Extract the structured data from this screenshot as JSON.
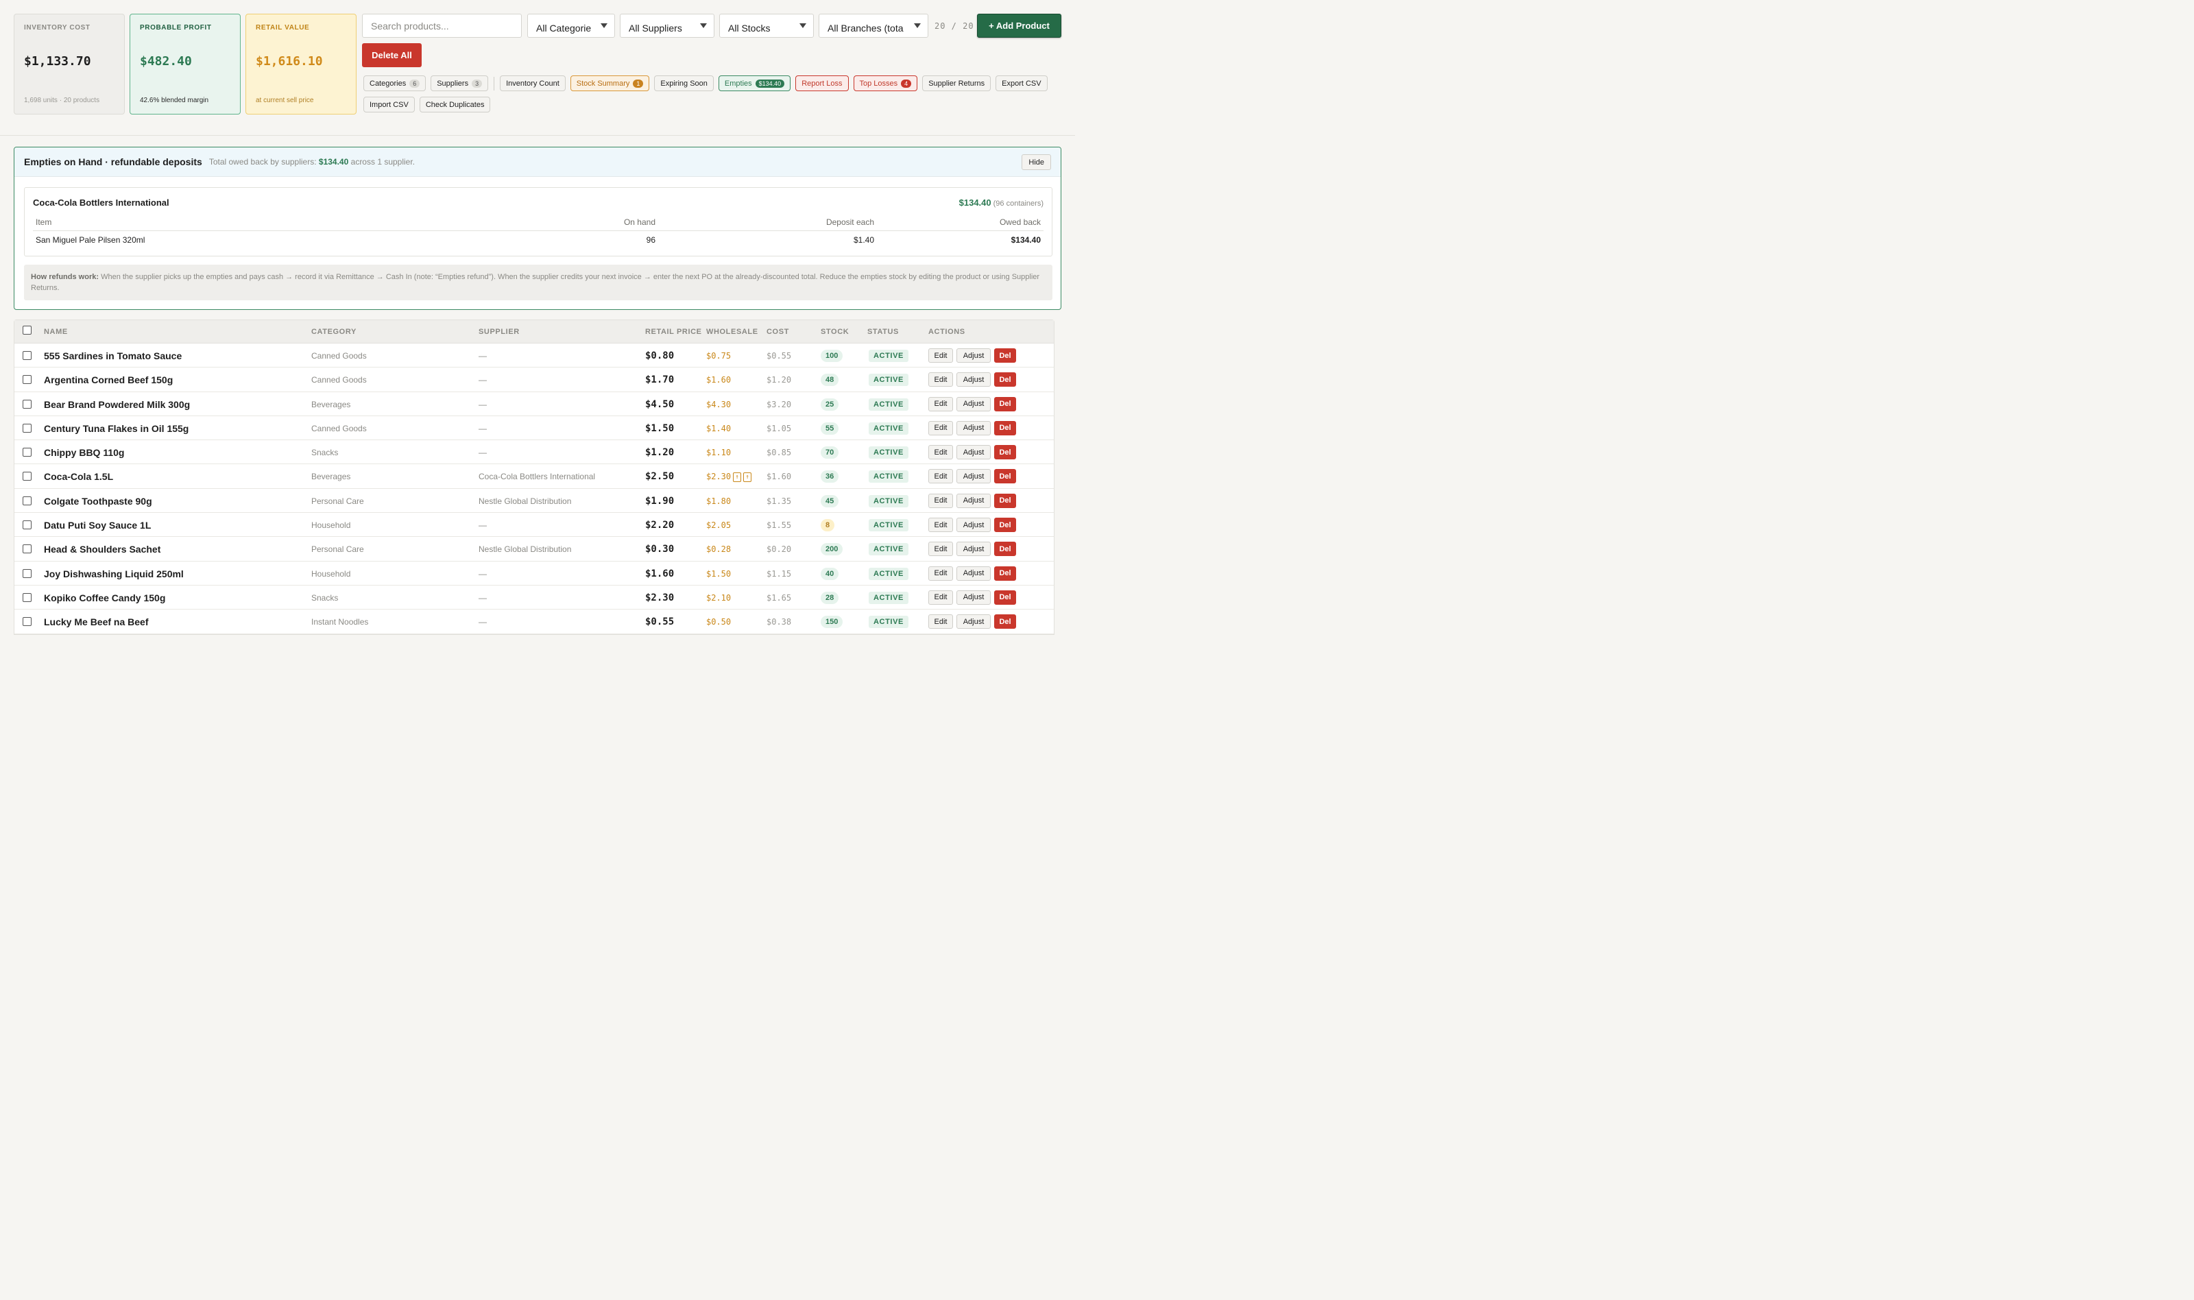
{
  "stats": {
    "inventory_cost": {
      "label": "INVENTORY COST",
      "value": "$1,133.70",
      "sub": "1,698 units · 20 products"
    },
    "probable_profit": {
      "label": "PROBABLE PROFIT",
      "value": "$482.40",
      "sub": "42.6% blended margin"
    },
    "retail_value": {
      "label": "RETAIL VALUE",
      "value": "$1,616.10",
      "sub": "at current sell price"
    }
  },
  "toolbar": {
    "search_placeholder": "Search products...",
    "filter_category": "All Categorie",
    "filter_supplier": "All Suppliers",
    "filter_stock": "All Stocks",
    "filter_branch": "All Branches (tota",
    "count": "20 / 20",
    "add_product": "+ Add Product",
    "delete_all": "Delete All"
  },
  "chips": {
    "categories": {
      "label": "Categories",
      "badge": "6"
    },
    "suppliers": {
      "label": "Suppliers",
      "badge": "3"
    },
    "inventory_count": {
      "label": "Inventory Count"
    },
    "stock_summary": {
      "label": "Stock Summary",
      "badge": "1"
    },
    "expiring_soon": {
      "label": "Expiring Soon"
    },
    "empties": {
      "label": "Empties",
      "badge": "$134.40"
    },
    "report_loss": {
      "label": "Report Loss"
    },
    "top_losses": {
      "label": "Top Losses",
      "badge": "4"
    },
    "supplier_returns": {
      "label": "Supplier Returns"
    },
    "export_csv": {
      "label": "Export CSV"
    },
    "import_csv": {
      "label": "Import CSV"
    },
    "check_duplicates": {
      "label": "Check Duplicates"
    }
  },
  "empties": {
    "title": "Empties on Hand · refundable deposits",
    "note_prefix": "Total owed back by suppliers:",
    "note_amount": "$134.40",
    "note_suffix": "across 1 supplier.",
    "hide": "Hide",
    "supplier": {
      "name": "Coca-Cola Bottlers International",
      "total": "$134.40",
      "containers": "(96 containers)",
      "headers": {
        "item": "Item",
        "on_hand": "On hand",
        "deposit_each": "Deposit each",
        "owed_back": "Owed back"
      },
      "row": {
        "item": "San Miguel Pale Pilsen 320ml",
        "on_hand": "96",
        "deposit_each": "$1.40",
        "owed_back": "$134.40"
      }
    },
    "how_label": "How refunds work:",
    "how_text": "When the supplier picks up the empties and pays cash → record it via Remittance → Cash In (note: “Empties refund”). When the supplier credits your next invoice → enter the next PO at the already-discounted total. Reduce the empties stock by editing the product or using Supplier Returns."
  },
  "table": {
    "headers": {
      "name": "NAME",
      "category": "CATEGORY",
      "supplier": "SUPPLIER",
      "retail": "RETAIL PRICE",
      "wholesale": "WHOLESALE",
      "cost": "COST",
      "stock": "STOCK",
      "status": "STATUS",
      "actions": "ACTIONS"
    },
    "action_labels": {
      "edit": "Edit",
      "adjust": "Adjust",
      "del": "Del"
    },
    "rows": [
      {
        "name": "555 Sardines in Tomato Sauce",
        "category": "Canned Goods",
        "supplier": "—",
        "retail": "$0.80",
        "wholesale": "$0.75",
        "cost": "$0.55",
        "stock": "100",
        "status": "ACTIVE"
      },
      {
        "name": "Argentina Corned Beef 150g",
        "category": "Canned Goods",
        "supplier": "—",
        "retail": "$1.70",
        "wholesale": "$1.60",
        "cost": "$1.20",
        "stock": "48",
        "status": "ACTIVE"
      },
      {
        "name": "Bear Brand Powdered Milk 300g",
        "category": "Beverages",
        "supplier": "—",
        "retail": "$4.50",
        "wholesale": "$4.30",
        "cost": "$3.20",
        "stock": "25",
        "status": "ACTIVE"
      },
      {
        "name": "Century Tuna Flakes in Oil 155g",
        "category": "Canned Goods",
        "supplier": "—",
        "retail": "$1.50",
        "wholesale": "$1.40",
        "cost": "$1.05",
        "stock": "55",
        "status": "ACTIVE"
      },
      {
        "name": "Chippy BBQ 110g",
        "category": "Snacks",
        "supplier": "—",
        "retail": "$1.20",
        "wholesale": "$1.10",
        "cost": "$0.85",
        "stock": "70",
        "status": "ACTIVE"
      },
      {
        "name": "Coca-Cola 1.5L",
        "category": "Beverages",
        "supplier": "Coca-Cola Bottlers International",
        "retail": "$2.50",
        "wholesale": "$2.30",
        "cost": "$1.60",
        "stock": "36",
        "status": "ACTIVE"
      },
      {
        "name": "Colgate Toothpaste 90g",
        "category": "Personal Care",
        "supplier": "Nestle Global Distribution",
        "retail": "$1.90",
        "wholesale": "$1.80",
        "cost": "$1.35",
        "stock": "45",
        "status": "ACTIVE"
      },
      {
        "name": "Datu Puti Soy Sauce 1L",
        "category": "Household",
        "supplier": "—",
        "retail": "$2.20",
        "wholesale": "$2.05",
        "cost": "$1.55",
        "stock": "8",
        "status": "ACTIVE"
      },
      {
        "name": "Head & Shoulders Sachet",
        "category": "Personal Care",
        "supplier": "Nestle Global Distribution",
        "retail": "$0.30",
        "wholesale": "$0.28",
        "cost": "$0.20",
        "stock": "200",
        "status": "ACTIVE"
      },
      {
        "name": "Joy Dishwashing Liquid 250ml",
        "category": "Household",
        "supplier": "—",
        "retail": "$1.60",
        "wholesale": "$1.50",
        "cost": "$1.15",
        "stock": "40",
        "status": "ACTIVE"
      },
      {
        "name": "Kopiko Coffee Candy 150g",
        "category": "Snacks",
        "supplier": "—",
        "retail": "$2.30",
        "wholesale": "$2.10",
        "cost": "$1.65",
        "stock": "28",
        "status": "ACTIVE"
      },
      {
        "name": "Lucky Me Beef na Beef",
        "category": "Instant Noodles",
        "supplier": "—",
        "retail": "$0.55",
        "wholesale": "$0.50",
        "cost": "$0.38",
        "stock": "150",
        "status": "ACTIVE"
      }
    ]
  }
}
